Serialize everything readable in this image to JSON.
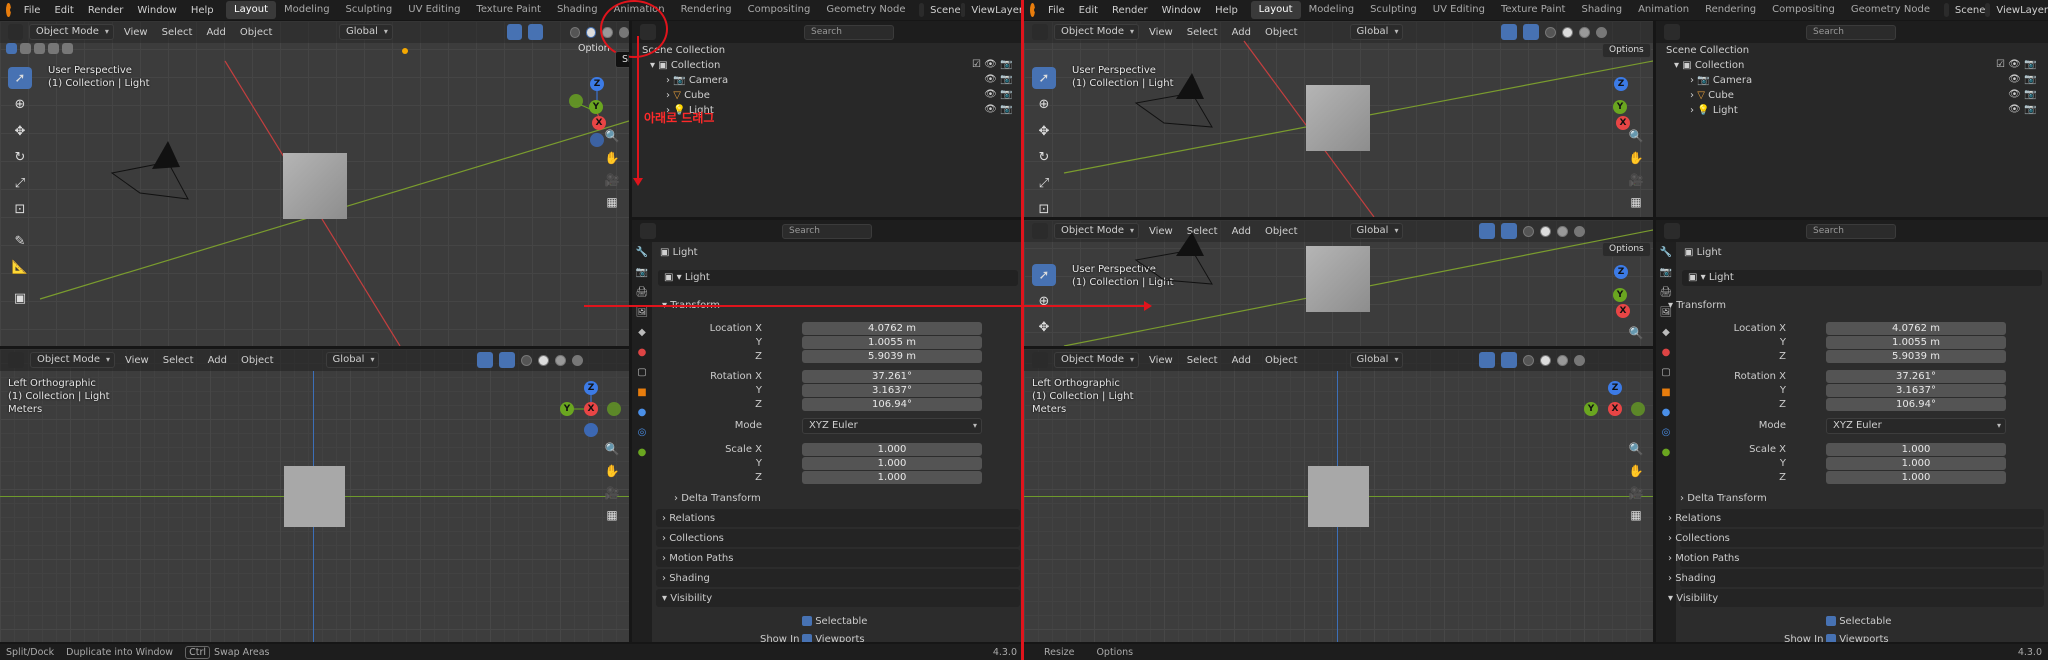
{
  "menu": {
    "items": [
      "File",
      "Edit",
      "Render",
      "Window",
      "Help"
    ],
    "workspaces": [
      "Layout",
      "Modeling",
      "Sculpting",
      "UV Editing",
      "Texture Paint",
      "Shading",
      "Animation",
      "Rendering",
      "Compositing",
      "Geometry Node"
    ],
    "workspaces_right": [
      "Layout",
      "Modeling",
      "Sculpting",
      "UV Editing",
      "Texture Paint",
      "Shading",
      "Animation",
      "Rendering",
      "Compositing",
      "Geometry Node"
    ],
    "active_workspace": "Layout",
    "scene": "Scene",
    "view_layer": "ViewLayer"
  },
  "viewport_header": {
    "mode": "Object Mode",
    "view": "View",
    "select": "Select",
    "add": "Add",
    "object": "Object",
    "transform": "Global",
    "options": "Options"
  },
  "viewport_persp": {
    "title": "User Perspective",
    "subtitle": "(1) Collection | Light"
  },
  "viewport_ortho": {
    "title": "Left Orthographic",
    "subtitle": "(1) Collection | Light",
    "units": "Meters"
  },
  "tooltip": {
    "options": "Option",
    "shading": "Shading"
  },
  "annotation": {
    "drag_down": "아래로 드래그"
  },
  "outliner": {
    "search_placeholder": "Search",
    "scene_collection": "Scene Collection",
    "collection": "Collection",
    "items": [
      "Camera",
      "Cube",
      "Light"
    ]
  },
  "properties": {
    "search_placeholder": "Search",
    "object_name": "Light",
    "data_name": "Light",
    "transform_label": "Transform",
    "location_label": "Location X",
    "location": {
      "x": "4.0762 m",
      "y": "1.0055 m",
      "z": "5.9039 m"
    },
    "rotation_label": "Rotation X",
    "rotation": {
      "x": "37.261°",
      "y": "3.1637°",
      "z": "106.94°"
    },
    "mode_label": "Mode",
    "mode_value": "XYZ Euler",
    "scale_label": "Scale X",
    "scale": {
      "x": "1.000",
      "y": "1.000",
      "z": "1.000"
    },
    "axis_y": "Y",
    "axis_z": "Z",
    "delta_transform": "Delta Transform",
    "relations": "Relations",
    "collections": "Collections",
    "motion_paths": "Motion Paths",
    "shading": "Shading",
    "visibility": "Visibility",
    "selectable": "Selectable",
    "show_in": "Show In",
    "viewports": "Viewports"
  },
  "status_left": {
    "split": "Split/Dock",
    "duplicate": "Duplicate into Window",
    "ctrl": "Ctrl",
    "swap": "Swap Areas",
    "version": "4.3.0"
  },
  "status_right": {
    "resize": "Resize",
    "options": "Options",
    "version": "4.3.0"
  },
  "colors": {
    "accent": "#4772b3",
    "annotation_red": "#e0141c",
    "x_axis": "#e84545",
    "y_axis": "#6aa620",
    "z_axis": "#3c7be6"
  }
}
